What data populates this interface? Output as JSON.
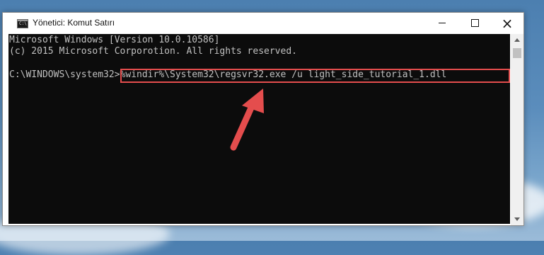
{
  "window": {
    "title": "Yönetici: Komut Satırı",
    "icon": "cmd-icon",
    "controls": {
      "minimize": "minimize-icon",
      "maximize": "maximize-icon",
      "close": "×"
    }
  },
  "console": {
    "lines": [
      "Microsoft Windows [Version 10.0.10586]",
      "(c) 2015 Microsoft Corporotion. All rights reserved."
    ],
    "prompt": "C:\\WINDOWS\\system32>",
    "command": "%windir%\\System32\\regsvr32.exe /u light_side_tutorial_1.dll"
  },
  "annotation": {
    "highlight_color": "#e44d4d",
    "arrow_color": "#e44d4d"
  },
  "colors": {
    "console_bg": "#0c0c0c",
    "console_text": "#c0c0c0"
  }
}
